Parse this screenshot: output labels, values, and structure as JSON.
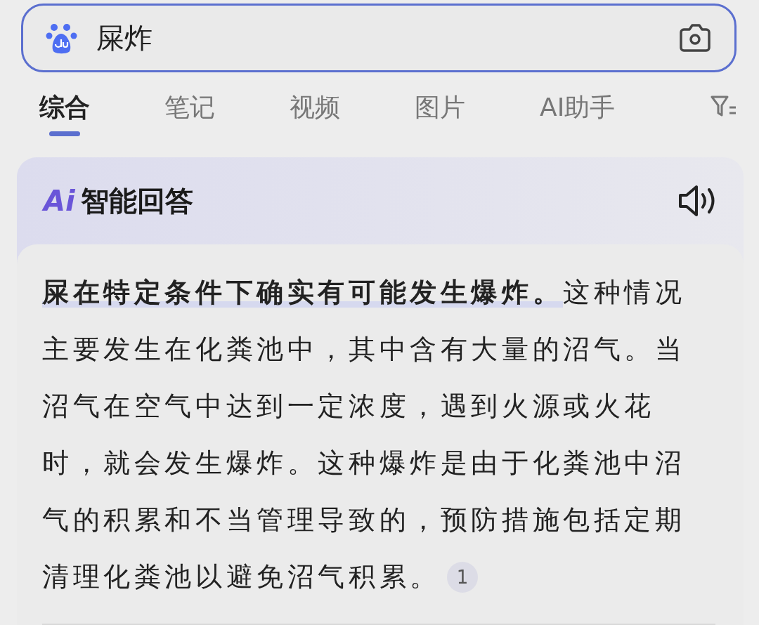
{
  "search": {
    "value": "屎炸"
  },
  "tabs": [
    {
      "label": "综合",
      "selected": true
    },
    {
      "label": "笔记",
      "selected": false
    },
    {
      "label": "视频",
      "selected": false
    },
    {
      "label": "图片",
      "selected": false
    },
    {
      "label": "AI助手",
      "selected": false
    }
  ],
  "answer": {
    "badge": "Ai",
    "title": "智能回答",
    "text": "**屎在特定条件下确实有可能发生爆炸。**这种情况主要发生在化粪池中，其中含有大量的沼气。当沼气在空气中达到一定浓度，遇到火源或火花时，就会发生爆炸。这种爆炸是由于化粪池中沼气的积累和不当管理导致的，预防措施包括定期清理化粪池以避免沼气积累。",
    "citation": "1"
  }
}
